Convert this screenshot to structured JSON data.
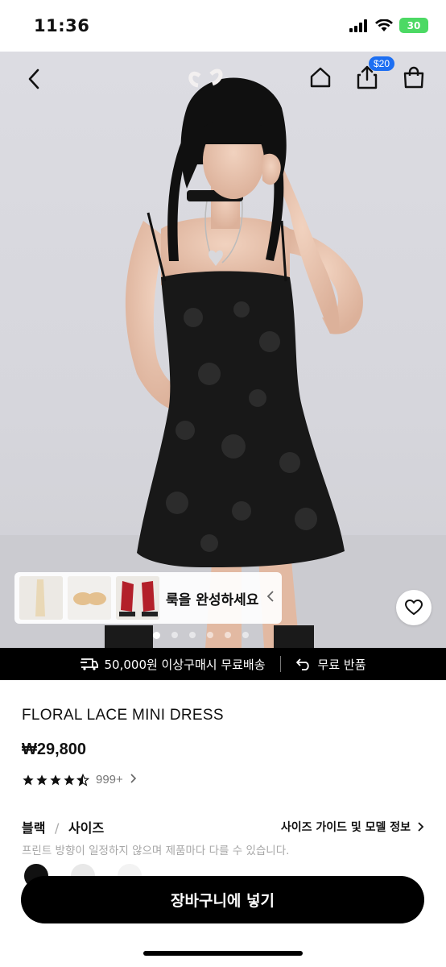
{
  "status_bar": {
    "time": "11:36",
    "battery": "30"
  },
  "header": {
    "share_badge": "$20"
  },
  "look_card": {
    "text": "룩을 완성하세요"
  },
  "carousel": {
    "dot_count": 6,
    "active_index": 0
  },
  "shipping_banner": {
    "free_shipping": "50,000원 이상구매시 무료배송",
    "free_return": "무료 반품"
  },
  "product": {
    "title": "FLORAL LACE MINI DRESS",
    "price": "₩29,800",
    "rating": 4.5,
    "rating_count": "999+"
  },
  "variant": {
    "color": "블랙",
    "separator": "/",
    "size_label": "사이즈",
    "size_guide": "사이즈 가이드 및 모델 정보",
    "notice": "프린트 방향이 일정하지 않으며 제품마다 다를 수 있습니다."
  },
  "cart_button": {
    "label": "장바구니에 넣기"
  }
}
